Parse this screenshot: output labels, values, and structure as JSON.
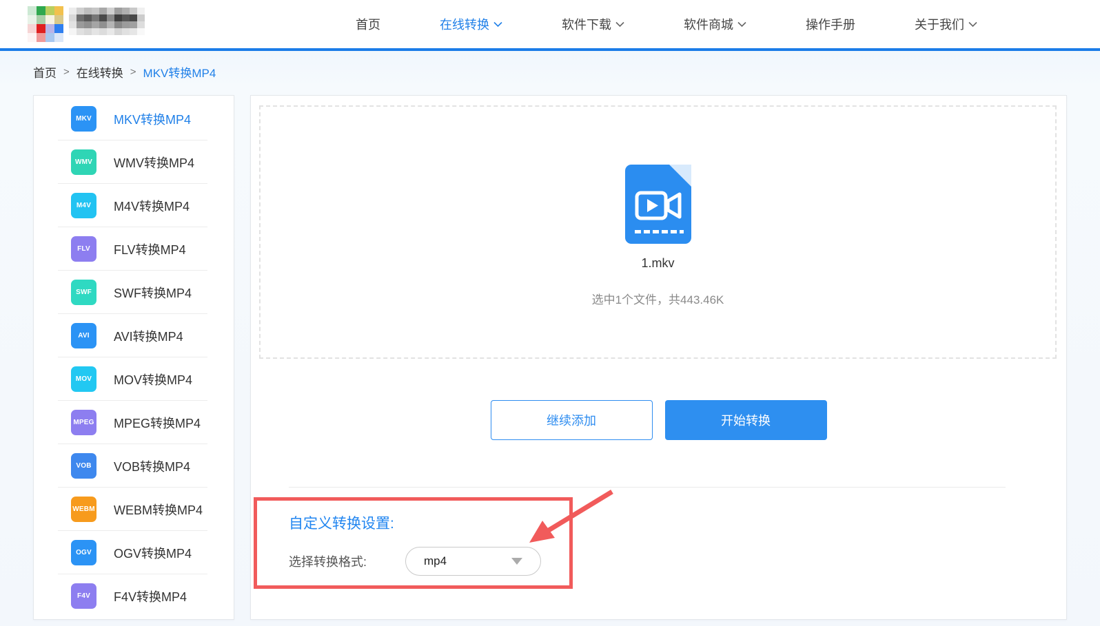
{
  "header": {
    "nav": [
      {
        "label": "首页"
      },
      {
        "label": "在线转换"
      },
      {
        "label": "软件下载"
      },
      {
        "label": "软件商城"
      },
      {
        "label": "操作手册"
      },
      {
        "label": "关于我们"
      }
    ]
  },
  "breadcrumb": {
    "separator": ">",
    "items": [
      "首页",
      "在线转换",
      "MKV转换MP4"
    ]
  },
  "logo": {
    "color_cells": [
      "#cde9d4",
      "#2fa84f",
      "#b9cf5f",
      "#f2c14e",
      "#e8f3e8",
      "#a9cfa9",
      "#f7f3e2",
      "#d9c98a",
      "#f6d5d5",
      "#e02020",
      "#b8b4e8",
      "#2f7ff0",
      "#fdf4f4",
      "#ef9a9a",
      "#a8c8f0",
      "#dbe7f8"
    ],
    "gray_cells": [
      "#ececec",
      "#cfcfcf",
      "#bdbdbd",
      "#c6c6c6",
      "#a8a8a8",
      "#d0d0d0",
      "#9e9e9e",
      "#b0b0b0",
      "#c9c9c9",
      "#f0f0f0",
      "#d8d8d8",
      "#6e6e6e",
      "#585858",
      "#777777",
      "#4a4a4a",
      "#8a8a8a",
      "#3f3f3f",
      "#565656",
      "#484848",
      "#cccccc",
      "#e2e2e2",
      "#9a9a9a",
      "#8f8f8f",
      "#a5a5a5",
      "#909090",
      "#b5b5b5",
      "#888888",
      "#9b9b9b",
      "#a0a0a0",
      "#dddddd",
      "#f5f5f5",
      "#e0e0e0",
      "#d8d8d8",
      "#e4e4e4",
      "#dcdcdc",
      "#e8e8e8",
      "#d5d5d5",
      "#e0e0e0",
      "#e6e6e6",
      "#f8f8f8"
    ]
  },
  "sidebar": {
    "items": [
      {
        "badge": "MKV",
        "label": "MKV转换MP4",
        "color": "#2b93f5"
      },
      {
        "badge": "WMV",
        "label": "WMV转换MP4",
        "color": "#2fd5b5"
      },
      {
        "badge": "M4V",
        "label": "M4V转换MP4",
        "color": "#22c3f2"
      },
      {
        "badge": "FLV",
        "label": "FLV转换MP4",
        "color": "#8d7ef0"
      },
      {
        "badge": "SWF",
        "label": "SWF转换MP4",
        "color": "#2fd9c2"
      },
      {
        "badge": "AVI",
        "label": "AVI转换MP4",
        "color": "#2b93f5"
      },
      {
        "badge": "MOV",
        "label": "MOV转换MP4",
        "color": "#22c8f2"
      },
      {
        "badge": "MPEG",
        "label": "MPEG转换MP4",
        "color": "#8d7ef0"
      },
      {
        "badge": "VOB",
        "label": "VOB转换MP4",
        "color": "#3e88ee"
      },
      {
        "badge": "WEBM",
        "label": "WEBM转换MP4",
        "color": "#f79b1d"
      },
      {
        "badge": "OGV",
        "label": "OGV转换MP4",
        "color": "#2b93f5"
      },
      {
        "badge": "F4V",
        "label": "F4V转换MP4",
        "color": "#8d7ef0"
      }
    ]
  },
  "main": {
    "file": {
      "name": "1.mkv"
    },
    "summary": "选中1个文件，共443.46K",
    "buttons": {
      "add": "继续添加",
      "convert": "开始转换"
    },
    "settings": {
      "title": "自定义转换设置:",
      "format_label": "选择转换格式:",
      "format_value": "mp4"
    }
  },
  "colors": {
    "accent_blue": "#2080e8",
    "button_blue": "#2e8ff0",
    "annotation_red": "#f15b5b",
    "header_line": "#1b7ce8"
  }
}
